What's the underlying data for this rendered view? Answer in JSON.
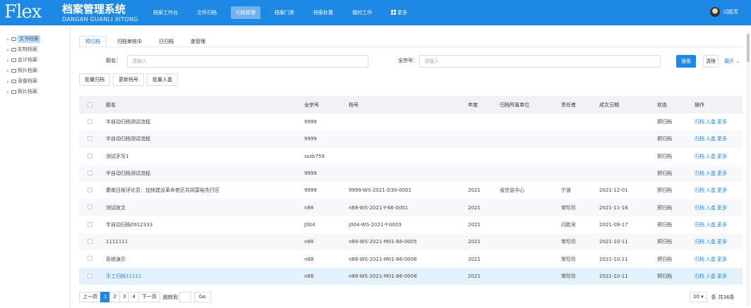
{
  "header": {
    "logo": "Flex",
    "title": "档案管理系统",
    "subtitle": "DANGAN GUANLI XITONG",
    "nav": [
      {
        "label": "档案工作台",
        "active": false
      },
      {
        "label": "文件归档",
        "active": false
      },
      {
        "label": "归档管理",
        "active": true
      },
      {
        "label": "档案门类",
        "active": false
      },
      {
        "label": "档案处置",
        "active": false
      },
      {
        "label": "我的工作",
        "active": false
      },
      {
        "label": "更多",
        "active": false,
        "icon": "grid-icon"
      }
    ],
    "user": "闫胜芳"
  },
  "sidebar": {
    "items": [
      {
        "label": "文书档案",
        "active": true
      },
      {
        "label": "实物档案",
        "active": false
      },
      {
        "label": "会计档案",
        "active": false
      },
      {
        "label": "照片档案",
        "active": false
      },
      {
        "label": "录像档案",
        "active": false
      },
      {
        "label": "照片档案",
        "active": false
      }
    ]
  },
  "tabs": [
    {
      "label": "预归档",
      "active": true
    },
    {
      "label": "归档审核中",
      "active": false
    },
    {
      "label": "已归档",
      "active": false
    },
    {
      "label": "查管理",
      "active": false
    }
  ],
  "search": {
    "title_label": "题名：",
    "title_placeholder": "请输入",
    "fonds_label": "全宗号：",
    "fonds_placeholder": "请输入",
    "search_btn": "搜索",
    "clear_btn": "清除",
    "expand": "展开 ⌄"
  },
  "actions": [
    "批量归档",
    "更新档号",
    "批量入盒"
  ],
  "table": {
    "headers": {
      "title": "题名",
      "fonds": "全宗号",
      "ref": "档号",
      "year": "年度",
      "unit": "归档所属单位",
      "resp": "责任者",
      "date": "成文日期",
      "status": "状态",
      "ops": "操作"
    },
    "op_labels": [
      "归档",
      "入盒",
      "更多"
    ],
    "rows": [
      {
        "title": "半自动归档测试流程",
        "fonds": "9999",
        "ref": "",
        "year": "",
        "unit": "",
        "resp": "",
        "date": "",
        "status": "预归档"
      },
      {
        "title": "半自动归档测试流程",
        "fonds": "9999",
        "ref": "",
        "year": "",
        "unit": "",
        "resp": "",
        "date": "",
        "status": "预归档"
      },
      {
        "title": "测试手写1",
        "fonds": "szzb759",
        "ref": "",
        "year": "",
        "unit": "",
        "resp": "",
        "date": "",
        "status": "预归档"
      },
      {
        "title": "半自动归档测试流程",
        "fonds": "9999",
        "ref": "",
        "year": "",
        "unit": "",
        "resp": "",
        "date": "",
        "status": "预归档"
      },
      {
        "title": "綦南日报评论员：加快建设革命老区共同富裕先行区",
        "fonds": "9999",
        "ref": "9999-WS-2021-D30-0001",
        "year": "2021",
        "unit": "省信息中心",
        "resp": "宁波",
        "date": "2021-12-01",
        "status": "预归档"
      },
      {
        "title": "测试收文",
        "fonds": "n88",
        "ref": "n88-WS-2021-Y-66-0001",
        "year": "2021",
        "unit": "",
        "resp": "常珍珍",
        "date": "2021-11-16",
        "status": "预归档"
      },
      {
        "title": "半自动归档0912333",
        "fonds": "J004",
        "ref": "J004-WS-2021-Y-0003",
        "year": "2021",
        "unit": "",
        "resp": "闫胜安",
        "date": "2021-09-17",
        "status": "预归档"
      },
      {
        "title": "1111111",
        "fonds": "n88",
        "ref": "n88-WS-2021-M01-66-0005",
        "year": "2021",
        "unit": "",
        "resp": "常珍珍",
        "date": "2021-10-11",
        "status": "预归档"
      },
      {
        "title": "系统演示",
        "fonds": "n88",
        "ref": "n88-WS-2021-M01-66-0006",
        "year": "2021",
        "unit": "",
        "resp": "常珍珍",
        "date": "2021-10-11",
        "status": "预归档"
      },
      {
        "title": "手工归档11111",
        "fonds": "n88",
        "ref": "n88-WS-2021-M01-66-0008",
        "year": "2021",
        "unit": "",
        "resp": "常珍珍",
        "date": "2021-10-11",
        "status": "预归档",
        "highlight": true
      }
    ]
  },
  "pager": {
    "prev": "上一页",
    "pages": [
      "1",
      "2",
      "3",
      "4"
    ],
    "current": "1",
    "next": "下一页",
    "goto_label": "跳转到",
    "go": "Go",
    "page_size": "10 ▾",
    "per_page": "条",
    "total": "共36条"
  }
}
